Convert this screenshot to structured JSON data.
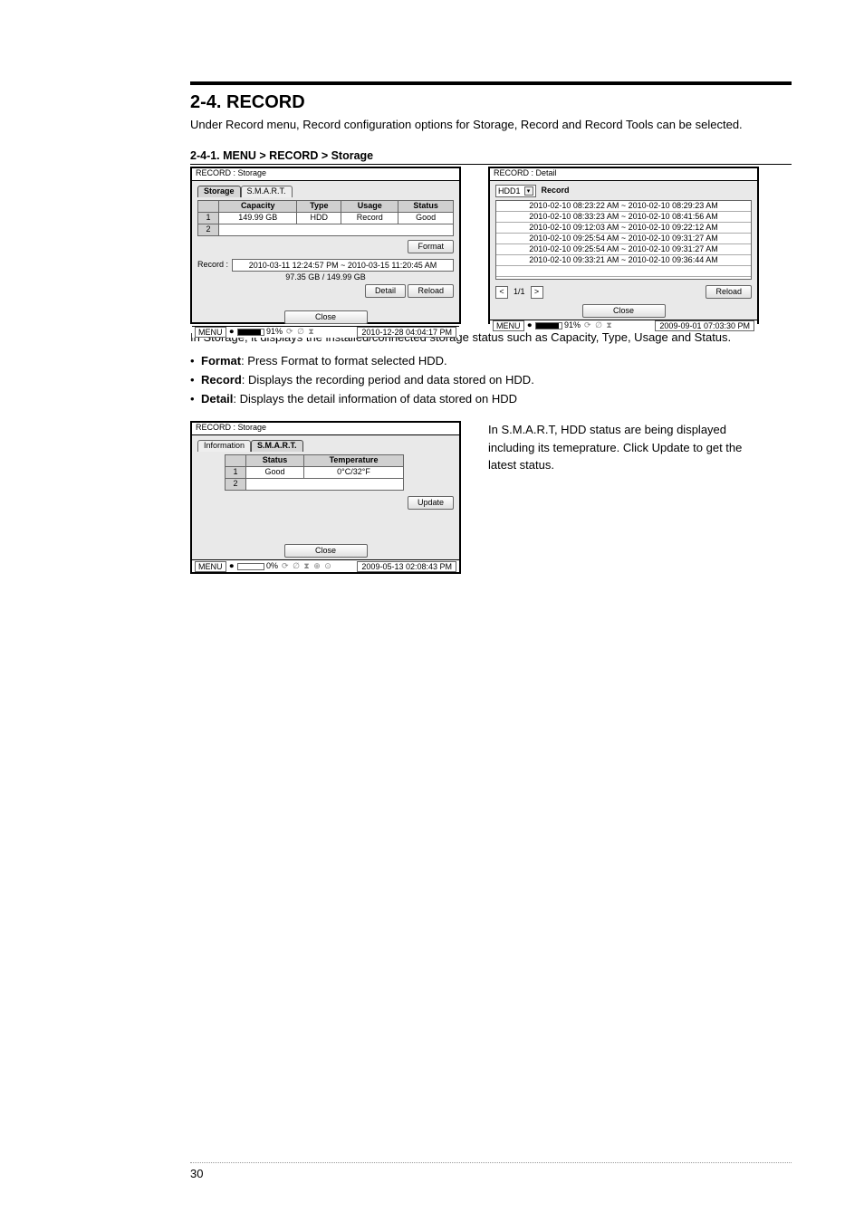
{
  "title": "2-4. RECORD",
  "intro": "Under Record menu, Record configuration options for Storage, Record and Record Tools can be selected.",
  "subhead": "2-4-1. MENU > RECORD > Storage",
  "storage_text": "In Storage, it displays the installed/connected storage status such as Capacity, Type, Usage and Status.",
  "bullets": [
    {
      "bold": "Format",
      "rest": ": Press Format to format selected HDD."
    },
    {
      "bold": "Record",
      "rest": ": Displays the recording period and data stored on HDD."
    },
    {
      "bold": "Detail",
      "rest": ": Displays the detail information of data stored on HDD"
    }
  ],
  "smart_text": "In S.M.A.R.T, HDD status are being displayed including its temeprature. Click Update to get the latest status.",
  "page_number": "30",
  "dlg1": {
    "title": "RECORD : Storage",
    "tabs": [
      "Storage",
      "S.M.A.R.T."
    ],
    "headers": [
      "",
      "Capacity",
      "Type",
      "Usage",
      "Status"
    ],
    "rows": [
      [
        "1",
        "149.99 GB",
        "HDD",
        "Record",
        "Good"
      ],
      [
        "2",
        "",
        "",
        "",
        ""
      ]
    ],
    "format_btn": "Format",
    "record_label": "Record :",
    "record_period": "2010-03-11 12:24:57 PM ~ 2010-03-15 11:20:45 AM",
    "record_size": "97.35 GB / 149.99 GB",
    "detail_btn": "Detail",
    "reload_btn": "Reload",
    "close_btn": "Close",
    "status_menu": "MENU",
    "status_pct": "91%",
    "status_fill_pct": 91,
    "status_time": "2010-12-28 04:04:17 PM"
  },
  "dlg2": {
    "title": "RECORD : Detail",
    "hdd_select": "HDD1",
    "record_lbl": "Record",
    "rows": [
      "2010-02-10 08:23:22 AM ~ 2010-02-10 08:29:23 AM",
      "2010-02-10 08:33:23 AM ~ 2010-02-10 08:41:56 AM",
      "2010-02-10 09:12:03 AM ~ 2010-02-10 09:22:12 AM",
      "2010-02-10 09:25:54 AM ~ 2010-02-10 09:31:27 AM",
      "2010-02-10 09:25:54 AM ~ 2010-02-10 09:31:27 AM",
      "2010-02-10 09:33:21 AM ~ 2010-02-10 09:36:44 AM"
    ],
    "page_indicator": "1/1",
    "reload_btn": "Reload",
    "close_btn": "Close",
    "status_menu": "MENU",
    "status_pct": "91%",
    "status_fill_pct": 91,
    "status_time": "2009-09-01 07:03:30 PM"
  },
  "dlg3": {
    "title": "RECORD : Storage",
    "tabs": [
      "Information",
      "S.M.A.R.T."
    ],
    "headers": [
      "",
      "Status",
      "Temperature"
    ],
    "rows": [
      [
        "1",
        "Good",
        "0°C/32°F"
      ],
      [
        "2",
        "",
        ""
      ]
    ],
    "update_btn": "Update",
    "close_btn": "Close",
    "status_menu": "MENU",
    "status_pct": "0%",
    "status_fill_pct": 0,
    "status_time": "2009-05-13 02:08:43 PM"
  }
}
